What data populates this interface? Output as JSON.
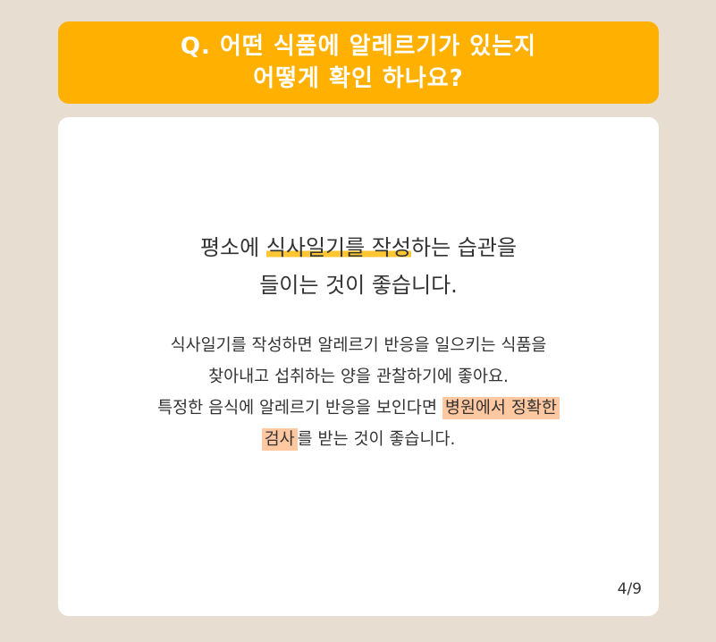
{
  "header": {
    "line1": "Q. 어떤 식품에 알레르기가 있는지",
    "line2": "어떻게 확인 하나요?"
  },
  "headline": {
    "line1_a": "평소에 ",
    "line1_mark": "식사일기를 작성",
    "line1_b": "하는 습관을",
    "line2": "들이는 것이 좋습니다."
  },
  "body": {
    "line1": "식사일기를 작성하면 알레르기 반응을 일으키는 식품을",
    "line2": "찾아내고 섭취하는 양을 관찰하기에 좋아요.",
    "line3_a": "특정한 음식에 알레르기 반응을 보인다면 ",
    "line3_hl": "병원에서 정확한",
    "line4_hl": "검사",
    "line4_b": "를 받는 것이 좋습니다."
  },
  "pagination": {
    "label": "4/9"
  },
  "colors": {
    "background": "#e8ddd1",
    "header": "#ffb000",
    "underline_mark": "#ffc533",
    "text_highlight": "#ffc8a0"
  }
}
